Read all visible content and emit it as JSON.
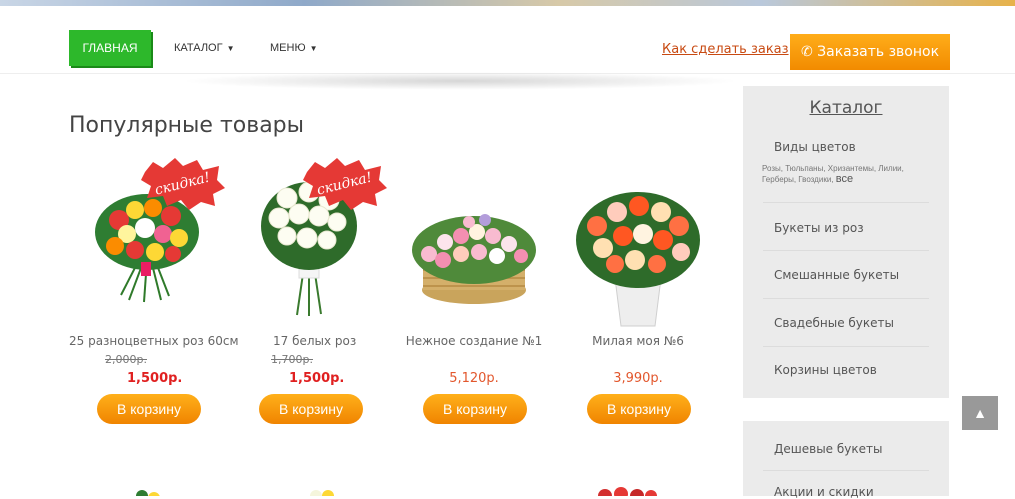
{
  "nav": {
    "home": "ГЛАВНАЯ",
    "catalog": "КАТАЛОГ",
    "menu": "МЕНЮ",
    "howto": "Как сделать заказ",
    "call": "Заказать звонок"
  },
  "main": {
    "title": "Популярные товары",
    "badge": "скидка!",
    "products": [
      {
        "name": "25 разноцветных роз 60см",
        "old_price": "2,000р.",
        "price": "1,500р.",
        "cart": "В корзину"
      },
      {
        "name": "17 белых роз",
        "old_price": "1,700р.",
        "price": "1,500р.",
        "cart": "В корзину"
      },
      {
        "name": "Нежное создание №1",
        "price": "5,120р.",
        "cart": "В корзину"
      },
      {
        "name": "Милая моя №6",
        "price": "3,990р.",
        "cart": "В корзину"
      }
    ]
  },
  "sidebar": {
    "title": "Каталог",
    "types_heading": "Виды цветов",
    "types_list": "Розы, Тюльпаны, Хризантемы, Лилии, Герберы, Гвоздики,",
    "types_all": "все",
    "items": [
      "Букеты из роз",
      "Смешанные букеты",
      "Свадебные букеты",
      "Корзины цветов"
    ],
    "items2": [
      "Дешевые букеты",
      "Акции и скидки"
    ]
  },
  "colors": {
    "accent": "#2db82b",
    "orange": "#f28b00",
    "sale_red": "#e02020"
  }
}
